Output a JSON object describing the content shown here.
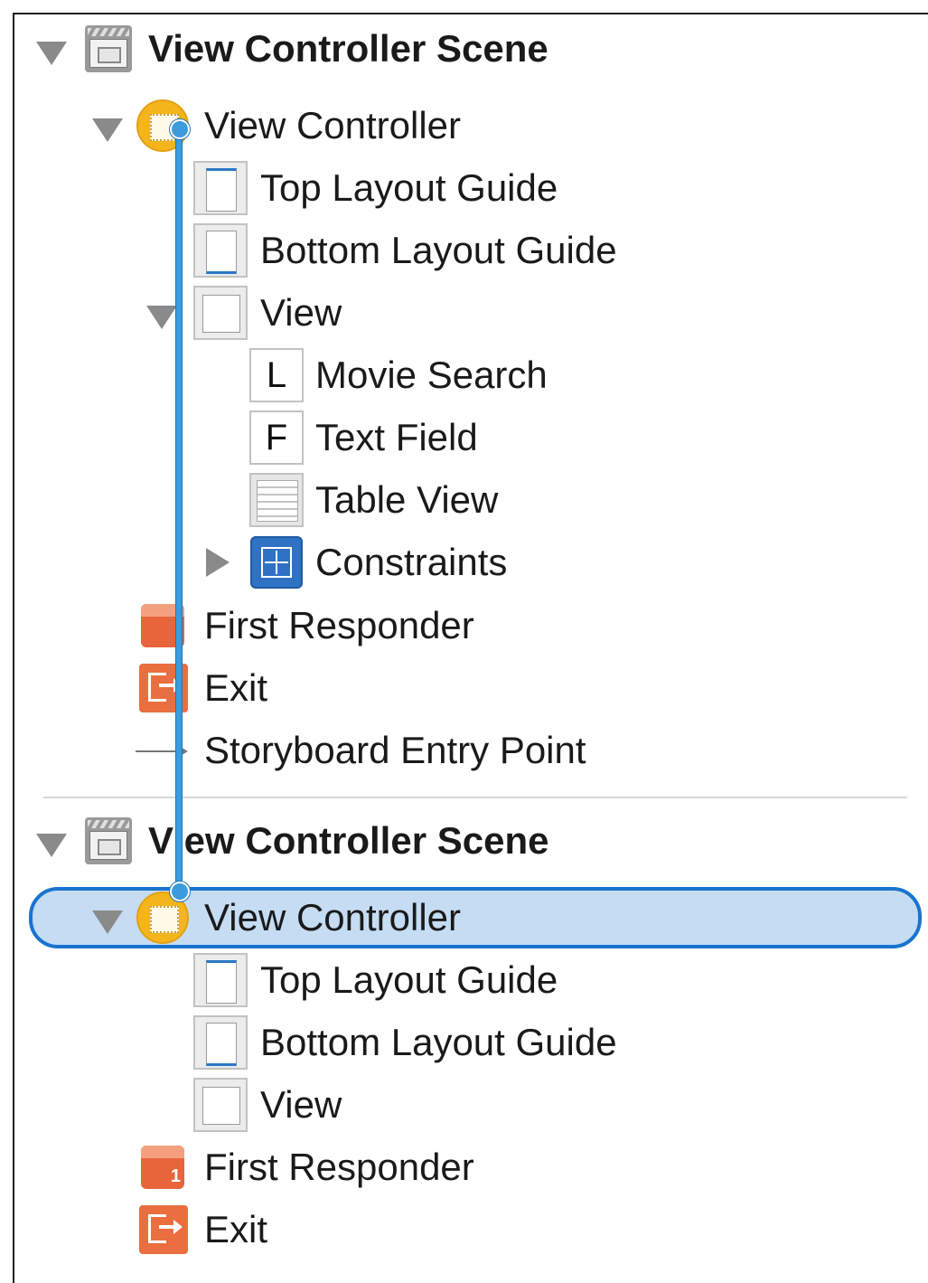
{
  "outline": {
    "scene1": {
      "title": "View Controller Scene",
      "view_controller": "View Controller",
      "top_layout_guide": "Top Layout Guide",
      "bottom_layout_guide": "Bottom Layout Guide",
      "view": "View",
      "movie_search": "Movie Search",
      "movie_search_badge": "L",
      "text_field": "Text Field",
      "text_field_badge": "F",
      "table_view": "Table View",
      "constraints": "Constraints",
      "first_responder": "First Responder",
      "exit": "Exit",
      "entry_point": "Storyboard Entry Point"
    },
    "scene2": {
      "title": "V ew Controller Scene",
      "view_controller": "View Controller",
      "top_layout_guide": "Top Layout Guide",
      "bottom_layout_guide": "Bottom Layout Guide",
      "view": "View",
      "first_responder": "First Responder",
      "first_responder_badge": "1",
      "exit": "Exit"
    }
  },
  "colors": {
    "selection_fill": "#c5dcf3",
    "selection_border": "#1a73cf",
    "connection_line": "#3b9bdc",
    "view_controller_icon": "#f4b51c",
    "responder_icon": "#e8643a"
  },
  "icons": [
    "scene-icon",
    "view-controller-icon",
    "layout-guide-icon",
    "view-icon",
    "label-icon",
    "text-field-icon",
    "table-view-icon",
    "constraints-icon",
    "first-responder-icon",
    "exit-icon",
    "entry-point-arrow-icon",
    "disclosure-triangle-icon"
  ]
}
